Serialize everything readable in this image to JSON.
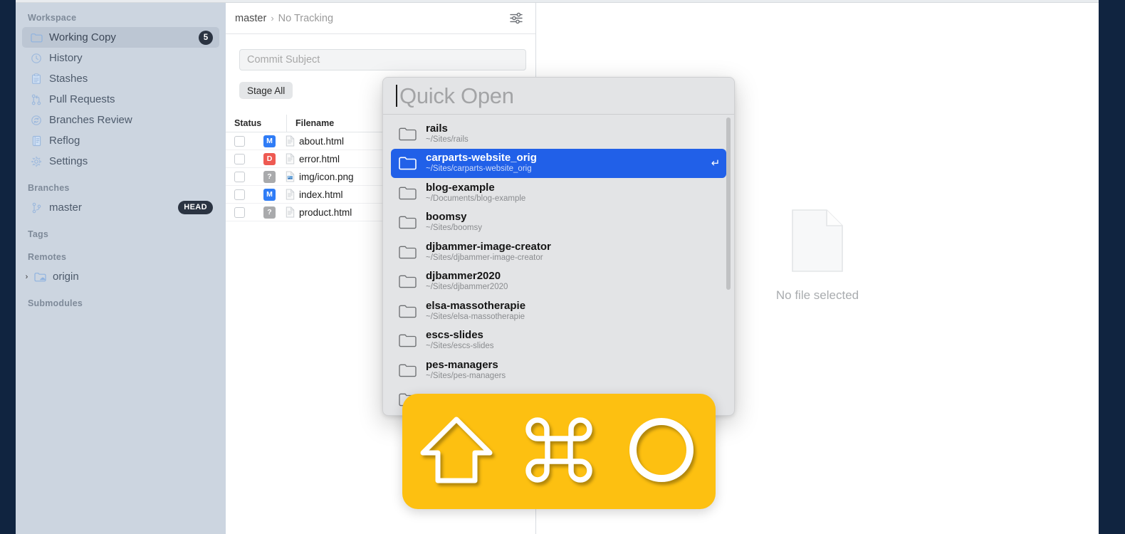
{
  "window": {
    "frame_color": "#102440",
    "sidebar_bg": "#ccd5e0",
    "accent_blue": "#2160e8",
    "overlay_yellow": "#fdc011"
  },
  "sidebar": {
    "sections": [
      {
        "title": "Workspace",
        "items": [
          {
            "label": "Working Copy",
            "icon": "folder-icon",
            "badge": "5",
            "selected": true
          },
          {
            "label": "History",
            "icon": "clock-icon",
            "badge": "",
            "selected": false
          },
          {
            "label": "Stashes",
            "icon": "clipboard-icon",
            "badge": "",
            "selected": false
          },
          {
            "label": "Pull Requests",
            "icon": "pull-request-icon",
            "badge": "",
            "selected": false
          },
          {
            "label": "Branches Review",
            "icon": "sync-circle-icon",
            "badge": "",
            "selected": false
          },
          {
            "label": "Reflog",
            "icon": "book-icon",
            "badge": "",
            "selected": false
          },
          {
            "label": "Settings",
            "icon": "gear-icon",
            "badge": "",
            "selected": false
          }
        ]
      },
      {
        "title": "Branches",
        "items": [
          {
            "label": "master",
            "icon": "branch-icon",
            "badge": "HEAD",
            "selected": false
          }
        ]
      },
      {
        "title": "Tags",
        "items": []
      },
      {
        "title": "Remotes",
        "items": [
          {
            "label": "origin",
            "icon": "remote-folder-icon",
            "badge": "",
            "selected": false,
            "disclosure": "›"
          }
        ]
      },
      {
        "title": "Submodules",
        "items": []
      }
    ]
  },
  "middle": {
    "breadcrumb": {
      "branch": "master",
      "separator": "›",
      "tracking": "No Tracking"
    },
    "filter_icon": "sliders-icon",
    "commit_subject_placeholder": "Commit Subject",
    "commit_subject_value": "",
    "stage_all_label": "Stage All",
    "table": {
      "columns": [
        "Status",
        "Filename"
      ],
      "rows": [
        {
          "status": "M",
          "status_class": "st-M",
          "filetype": "html",
          "filename": "about.html"
        },
        {
          "status": "D",
          "status_class": "st-D",
          "filetype": "html",
          "filename": "error.html"
        },
        {
          "status": "?",
          "status_class": "st-Q",
          "filetype": "image",
          "filename": "img/icon.png"
        },
        {
          "status": "M",
          "status_class": "st-M",
          "filetype": "html",
          "filename": "index.html"
        },
        {
          "status": "?",
          "status_class": "st-Q",
          "filetype": "html",
          "filename": "product.html"
        }
      ]
    }
  },
  "right_pane": {
    "empty_icon": "document-icon",
    "empty_label": "No file selected"
  },
  "quick_open": {
    "placeholder": "Quick Open",
    "query": "",
    "enter_symbol": "↵",
    "results": [
      {
        "name": "rails",
        "path": "~/Sites/rails",
        "selected": false
      },
      {
        "name": "carparts-website_orig",
        "path": "~/Sites/carparts-website_orig",
        "selected": true
      },
      {
        "name": "blog-example",
        "path": "~/Documents/blog-example",
        "selected": false
      },
      {
        "name": "boomsy",
        "path": "~/Sites/boomsy",
        "selected": false
      },
      {
        "name": "djbammer-image-creator",
        "path": "~/Sites/djbammer-image-creator",
        "selected": false
      },
      {
        "name": "djbammer2020",
        "path": "~/Sites/djbammer2020",
        "selected": false
      },
      {
        "name": "elsa-massotherapie",
        "path": "~/Sites/elsa-massotherapie",
        "selected": false
      },
      {
        "name": "escs-slides",
        "path": "~/Sites/escs-slides",
        "selected": false
      },
      {
        "name": "pes-managers",
        "path": "~/Sites/pes-managers",
        "selected": false
      },
      {
        "name": "",
        "path": "",
        "selected": false
      }
    ]
  },
  "shortcut_overlay": {
    "keys": [
      "shift-key-icon",
      "command-key-icon",
      "letter-o-key-icon"
    ],
    "keys_text": "⇧ ⌘ O"
  }
}
